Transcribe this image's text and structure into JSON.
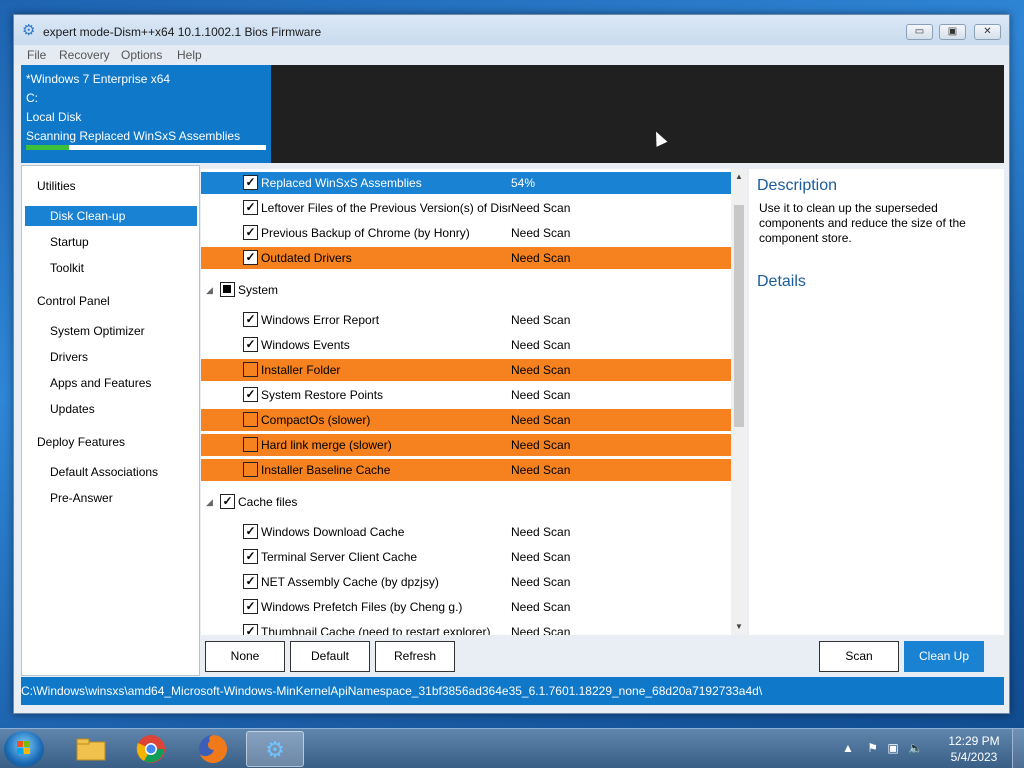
{
  "window": {
    "title": "expert mode-Dism++x64 10.1.1002.1 Bios Firmware",
    "controls": {
      "minimize": "▭",
      "maximize": "▣",
      "close": "✕"
    }
  },
  "menu": [
    "File",
    "Recovery",
    "Options",
    "Help"
  ],
  "header": {
    "os": "*Windows 7 Enterprise x64",
    "drive": "C:",
    "disk": "Local Disk",
    "task": "Scanning Replaced WinSxS Assemblies",
    "progress": 0.18
  },
  "sidebar": {
    "groups": [
      {
        "label": "Utilities",
        "items": [
          "Disk Clean-up",
          "Startup",
          "Toolkit"
        ]
      },
      {
        "label": "Control Panel",
        "items": [
          "System Optimizer",
          "Drivers",
          "Apps and Features",
          "Updates"
        ]
      },
      {
        "label": "Deploy Features",
        "items": [
          "Default Associations",
          "Pre-Answer"
        ]
      }
    ],
    "active": "Disk Clean-up"
  },
  "list": {
    "rows": [
      {
        "label": "Replaced WinSxS Assemblies",
        "status": "54%",
        "checked": true,
        "style": "selected"
      },
      {
        "label": "Leftover Files of the Previous Version(s) of Dism",
        "status": "Need Scan",
        "checked": true,
        "style": "normal"
      },
      {
        "label": "Previous Backup of Chrome (by Honry)",
        "status": "Need Scan",
        "checked": true,
        "style": "normal"
      },
      {
        "label": "Outdated Drivers",
        "status": "Need Scan",
        "checked": true,
        "style": "orange"
      }
    ],
    "system_group": "System",
    "system_rows": [
      {
        "label": "Windows Error Report",
        "status": "Need Scan",
        "checked": true,
        "style": "normal"
      },
      {
        "label": "Windows Events",
        "status": "Need Scan",
        "checked": true,
        "style": "normal"
      },
      {
        "label": "Installer Folder",
        "status": "Need Scan",
        "checked": false,
        "style": "orange"
      },
      {
        "label": "System Restore Points",
        "status": "Need Scan",
        "checked": true,
        "style": "normal"
      },
      {
        "label": "CompactOs (slower)",
        "status": "Need Scan",
        "checked": false,
        "style": "orange"
      },
      {
        "label": "Hard link merge (slower)",
        "status": "Need Scan",
        "checked": false,
        "style": "orange"
      },
      {
        "label": "Installer Baseline Cache",
        "status": "Need Scan",
        "checked": false,
        "style": "orange"
      }
    ],
    "cache_group": "Cache files",
    "cache_rows": [
      {
        "label": "Windows Download Cache",
        "status": "Need Scan",
        "checked": true,
        "style": "normal"
      },
      {
        "label": "Terminal Server Client Cache",
        "status": "Need Scan",
        "checked": true,
        "style": "normal"
      },
      {
        "label": "NET Assembly Cache (by dpzjsy)",
        "status": "Need Scan",
        "checked": true,
        "style": "normal"
      },
      {
        "label": "Windows Prefetch Files (by Cheng g.)",
        "status": "Need Scan",
        "checked": true,
        "style": "normal"
      },
      {
        "label": "Thumbnail Cache (need to restart explorer)",
        "status": "Need Scan",
        "checked": true,
        "style": "normal"
      }
    ]
  },
  "description": {
    "title": "Description",
    "body": "Use it to clean up the superseded components and reduce the size of the component store.",
    "details_title": "Details"
  },
  "buttons": {
    "none": "None",
    "default": "Default",
    "refresh": "Refresh",
    "scan": "Scan",
    "cleanup": "Clean Up"
  },
  "status_path": "C:\\Windows\\winsxs\\amd64_Microsoft-Windows-MinKernelApiNamespace_31bf3856ad364e35_6.1.7601.18229_none_68d20a7192733a4d\\",
  "taskbar": {
    "clock_time": "12:29 PM",
    "clock_date": "5/4/2023",
    "apps": [
      "file-explorer",
      "chrome",
      "firefox",
      "dism++"
    ]
  },
  "colors": {
    "accent": "#1a82d2",
    "warning": "#f6821f",
    "header_dark": "#202020"
  }
}
